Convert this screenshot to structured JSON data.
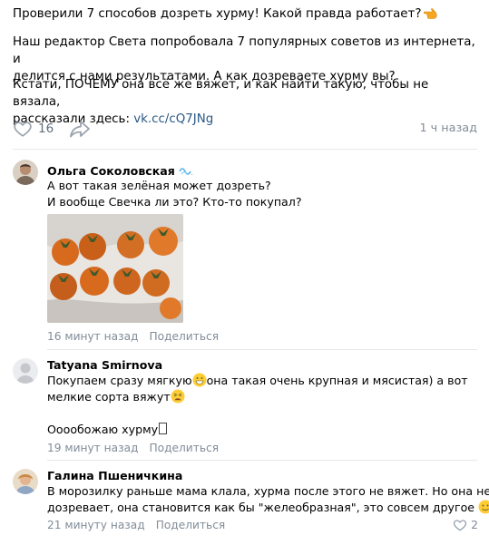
{
  "post": {
    "line1": "Проверили 7 способов дозреть хурму! Какой правда работает?",
    "para2_line1": "Наш редактор Света попробовала 7 популярных советов из интернета, и",
    "para2_line2": "делится с нами результатами. А как дозреваете хурму вы?",
    "para3_line1": "Кстати, ПОЧЕМУ она всё же вяжет, и как найти такую, чтобы не вязала,",
    "para3_prefix": "рассказали здесь: ",
    "link": "vk.cc/cQ7JNg",
    "likes": "16",
    "time": "1 ч назад"
  },
  "comments": [
    {
      "author": "Ольга Соколовская",
      "lines": [
        "А вот такая зелёная может дозреть?",
        "И вообще Свечка ли это? Кто-то покупал?"
      ],
      "time": "16 минут назад",
      "reply": "Поделиться"
    },
    {
      "author": "Tatyana Smirnova",
      "line1_a": "Покупаем сразу мягкую",
      "line1_b": "она такая очень крупная и мясистая) а вот",
      "line2": "мелкие сорта вяжут",
      "line3": "Ооообожаю хурму",
      "time": "19 минут назад",
      "reply": "Поделиться"
    },
    {
      "author": "Галина Пшеничкина",
      "line1": "В морозилку раньше мама клала, хурма после этого не вяжет. Но она не",
      "line2": "дозревает, она становится как бы \"желеобразная\", это совсем другое",
      "time": "21 минуту назад",
      "reply": "Поделиться",
      "likes": "2"
    }
  ],
  "colors": {
    "link": "#2a5885",
    "meta": "#818c99",
    "divider": "#e7e8ec"
  }
}
